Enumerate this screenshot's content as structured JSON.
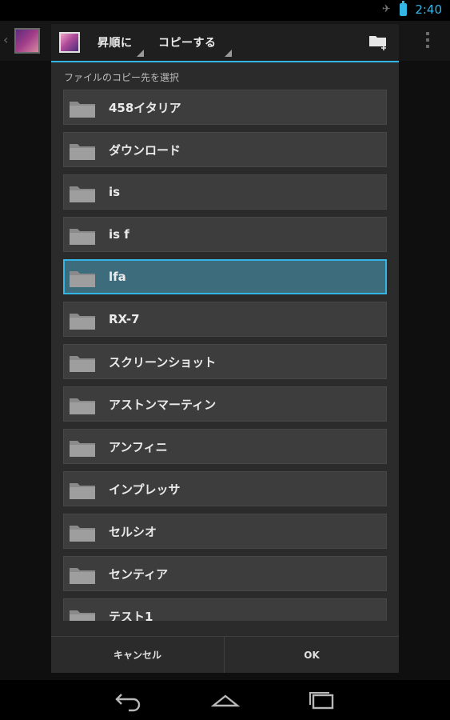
{
  "status_bar": {
    "time": "2:40"
  },
  "dialog": {
    "sort_label": "昇順に",
    "mode_label": "コピーする",
    "subtitle": "ファイルのコピー先を選択",
    "folders": [
      {
        "name": "458イタリア",
        "selected": false
      },
      {
        "name": "ダウンロード",
        "selected": false
      },
      {
        "name": "is",
        "selected": false
      },
      {
        "name": "is f",
        "selected": false
      },
      {
        "name": "lfa",
        "selected": true
      },
      {
        "name": "RX-7",
        "selected": false
      },
      {
        "name": "スクリーンショット",
        "selected": false
      },
      {
        "name": "アストンマーティン",
        "selected": false
      },
      {
        "name": "アンフィニ",
        "selected": false
      },
      {
        "name": "インプレッサ",
        "selected": false
      },
      {
        "name": "セルシオ",
        "selected": false
      },
      {
        "name": "センティア",
        "selected": false
      },
      {
        "name": "テスト1",
        "selected": false
      }
    ],
    "cancel_label": "キャンセル",
    "ok_label": "OK"
  },
  "colors": {
    "accent": "#33b5e5",
    "selected_bg": "#3d6c7d"
  }
}
